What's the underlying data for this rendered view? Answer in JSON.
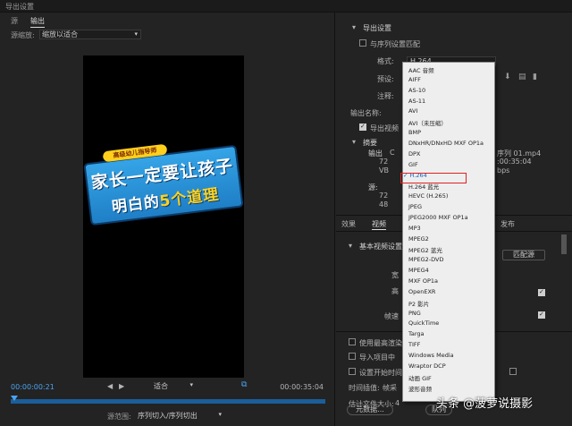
{
  "window": {
    "title": "导出设置"
  },
  "left": {
    "tabs": [
      "源",
      "输出"
    ],
    "scale_label": "源缩放:",
    "scale_value": "缩放以适合",
    "video": {
      "tag": "高级幼儿指导师",
      "line1": "家长一定要让孩子",
      "line2_a": "明白的",
      "line2_hl": "5个道理"
    },
    "timecode_in": "00:00:00:21",
    "timecode_out": "00:00:35:04",
    "fit_value": "适合",
    "range_label": "源范围:",
    "range_value": "序列切入/序列切出",
    "scrub_progress": 0
  },
  "right": {
    "section_export": "导出设置",
    "match_sequence": "与序列设置匹配",
    "format_label": "格式:",
    "format_value": "H.264",
    "preset_label": "预设:",
    "comment_label": "注释:",
    "output_name_label": "输出名称:",
    "export_video": "导出视频",
    "summary_label": "摘要",
    "output_label": "输出",
    "output_name_tail": "序列 01.mp4",
    "duration_tail": ":00:35:04",
    "bitrate_tail": "bps",
    "source_label": "源:",
    "frag_c": "C",
    "frag_vb": "VB",
    "frag_72a": "72",
    "frag_72b": "72",
    "frag_48": "48",
    "tabs": [
      "效果",
      "视频",
      "发布"
    ],
    "basic_video": "基本视频设置",
    "frag_chong": "宽",
    "frag_gao": "高",
    "frag_zhen": "帧速",
    "use_max_render": "使用最高渲染",
    "import_project": "导入项目中",
    "set_start_tc": "设置开始时间",
    "time_interp_label": "时间插值:",
    "time_interp_value": "帧采",
    "file_size_label": "估计文件大小:",
    "file_size_value": "4",
    "match_source": "匹配源",
    "btn_meta": "元数据...",
    "btn_queue": "队列"
  },
  "dropdown": {
    "items": [
      "AAC 音频",
      "AIFF",
      "AS-10",
      "AS-11",
      "AVI",
      "AVI（未压缩）",
      "BMP",
      "DNxHR/DNxHD MXF OP1a",
      "DPX",
      "GIF",
      "H.264",
      "H.264 蓝光",
      "HEVC (H.265)",
      "JPEG",
      "JPEG2000 MXF OP1a",
      "MP3",
      "MPEG2",
      "MPEG2 蓝光",
      "MPEG2-DVD",
      "MPEG4",
      "MXF OP1a",
      "OpenEXR",
      "P2 影片",
      "PNG",
      "QuickTime",
      "Targa",
      "TIFF",
      "Windows Media",
      "Wraptor DCP",
      "动画 GIF",
      "波形音频"
    ],
    "selected": "H.264",
    "check": "✓"
  },
  "watermark": "头条 @菠萝说摄影",
  "colors": {
    "accent": "#4aa3f0",
    "highlight_box": "#e02020",
    "banner": "#2a90d8",
    "tag": "#ffcf1c"
  }
}
